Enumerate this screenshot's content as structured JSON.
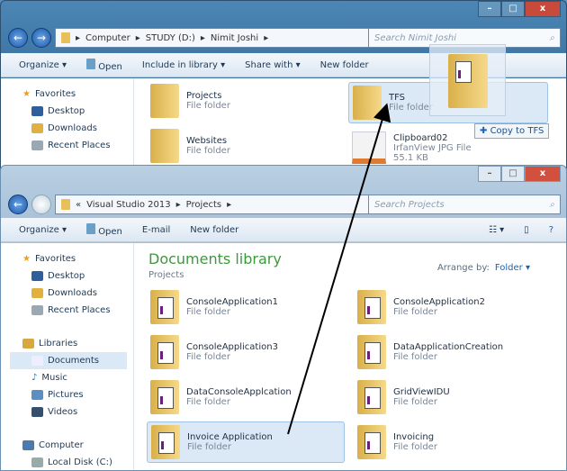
{
  "back_window": {
    "path": [
      "Computer",
      "STUDY (D:)",
      "Nimit Joshi"
    ],
    "search_placeholder": "Search Nimit Joshi",
    "toolbar": {
      "organize": "Organize ▾",
      "open": "Open",
      "include": "Include in library ▾",
      "share": "Share with ▾",
      "new_folder": "New folder"
    },
    "sidebar": {
      "favorites": "Favorites",
      "items": [
        "Desktop",
        "Downloads",
        "Recent Places"
      ]
    },
    "files": [
      {
        "name": "Projects",
        "type": "File folder"
      },
      {
        "name": "Websites",
        "type": "File folder"
      },
      {
        "name": "TFS",
        "type": "File folder"
      },
      {
        "name": "Clipboard02",
        "type": "IrfanView JPG File",
        "size": "55.1 KB"
      }
    ],
    "drop_tooltip": "Copy to TFS"
  },
  "front_window": {
    "path": [
      "«",
      "Visual Studio 2013",
      "Projects"
    ],
    "search_placeholder": "Search Projects",
    "toolbar": {
      "organize": "Organize ▾",
      "open": "Open",
      "email": "E-mail",
      "new_folder": "New folder"
    },
    "library_title": "Documents library",
    "library_sub": "Projects",
    "arrange_label": "Arrange by:",
    "arrange_value": "Folder ▾",
    "sidebar": {
      "favorites": "Favorites",
      "fav_items": [
        "Desktop",
        "Downloads",
        "Recent Places"
      ],
      "libraries": "Libraries",
      "lib_items": [
        "Documents",
        "Music",
        "Pictures",
        "Videos"
      ],
      "computer": "Computer",
      "comp_items": [
        "Local Disk (C:)"
      ]
    },
    "files": [
      {
        "name": "ConsoleApplication1",
        "type": "File folder"
      },
      {
        "name": "ConsoleApplication2",
        "type": "File folder"
      },
      {
        "name": "ConsoleApplication3",
        "type": "File folder"
      },
      {
        "name": "DataApplicationCreation",
        "type": "File folder"
      },
      {
        "name": "DataConsoleApplcation",
        "type": "File folder"
      },
      {
        "name": "GridViewIDU",
        "type": "File folder"
      },
      {
        "name": "Invoice Application",
        "type": "File folder"
      },
      {
        "name": "Invoicing",
        "type": "File folder"
      }
    ]
  },
  "colors": {
    "accent": "#1d62b5",
    "library_title": "#3c9a3c"
  }
}
